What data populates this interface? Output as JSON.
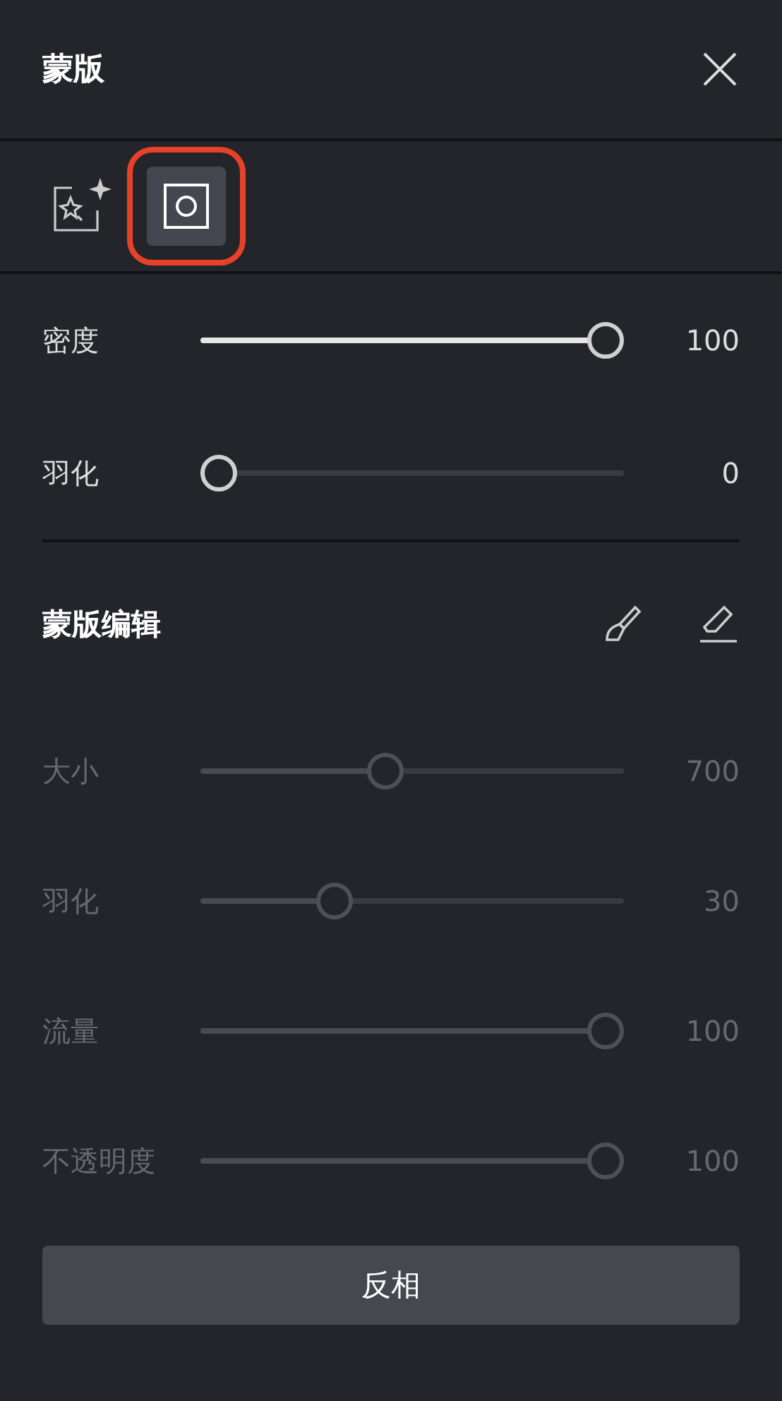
{
  "header": {
    "title": "蒙版"
  },
  "tabs": [
    {
      "kind": "smart",
      "selected": false
    },
    {
      "kind": "shape",
      "selected": true
    }
  ],
  "sliders": [
    {
      "label": "密度",
      "level": 1.0,
      "value": "100",
      "disabled": false
    },
    {
      "label": "羽化",
      "level": 0,
      "value": "0",
      "disabled": false
    }
  ],
  "edit_section": {
    "title": "蒙版编辑",
    "tools": [
      {
        "kind": "brush"
      },
      {
        "kind": "eraser"
      }
    ],
    "sliders": [
      {
        "label": "大小",
        "level": 0.43,
        "value": "700",
        "disabled": true
      },
      {
        "label": "羽化",
        "level": 0.3,
        "value": "30",
        "disabled": true
      },
      {
        "label": "流量",
        "level": 1.0,
        "value": "100",
        "disabled": true
      },
      {
        "label": "不透明度",
        "level": 1.0,
        "value": "100",
        "disabled": true
      }
    ]
  },
  "invert_button": {
    "label": "反相"
  }
}
